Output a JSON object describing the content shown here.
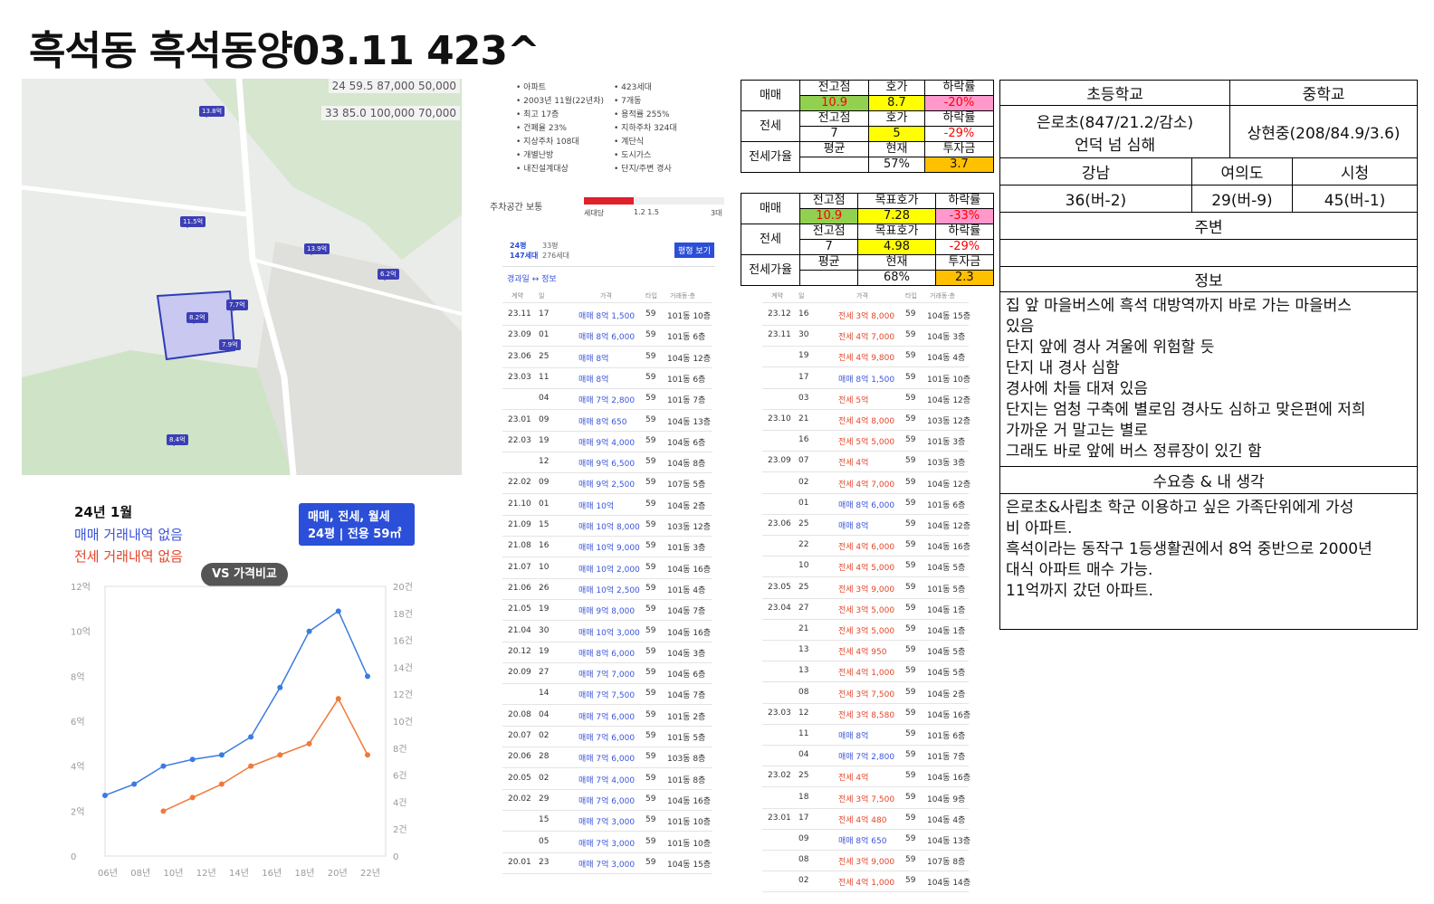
{
  "title": "흑석동 흑석동양03.11   423^",
  "map": {
    "legend_line1": "24 59.5 87,000 50,000",
    "legend_line2": "33 85.0 100,000 70,000",
    "pins": [
      "13.8억",
      "11.5억",
      "7.7억",
      "13.9억",
      "6.2억",
      "8.4억",
      "8.2억",
      "7.9억"
    ]
  },
  "chart": {
    "month": "24년 1월",
    "buy_none": "매매 거래내역 없음",
    "rent_none": "전세 거래내역 없음",
    "vs_label": "VS 가격비교",
    "filter_line1": "매매, 전세, 월세",
    "filter_line2": "24평 | 전용 59㎡",
    "left_ticks": [
      "12억",
      "10억",
      "8억",
      "6억",
      "4억",
      "2억",
      "0"
    ],
    "right_ticks": [
      "20건",
      "18건",
      "16건",
      "14건",
      "12건",
      "10건",
      "8건",
      "6건",
      "4건",
      "2건",
      "0"
    ],
    "x_ticks": [
      "06년",
      "08년",
      "10년",
      "12년",
      "14년",
      "16년",
      "18년",
      "20년",
      "22년"
    ]
  },
  "chart_data": {
    "type": "line",
    "x": [
      "2006",
      "2008",
      "2010",
      "2012",
      "2014",
      "2016",
      "2018",
      "2020",
      "2022",
      "2023"
    ],
    "series": [
      {
        "name": "매매",
        "values": [
          2.7,
          3.2,
          4.0,
          4.3,
          4.5,
          5.3,
          7.5,
          10.0,
          10.9,
          8.0
        ]
      },
      {
        "name": "전세",
        "values": [
          null,
          null,
          2.0,
          2.6,
          3.2,
          4.0,
          4.5,
          5.0,
          7.0,
          4.5
        ]
      }
    ],
    "ylim": [
      0,
      12
    ]
  },
  "complex_info": {
    "left": [
      "아파트",
      "2003년 11월(22년차)",
      "최고 17층",
      "건폐율 23%",
      "지상주차 108대",
      "개별난방",
      "내진설계대상"
    ],
    "right": [
      "423세대",
      "7개동",
      "용적률 255%",
      "지하주차 324대",
      "계단식",
      "도시가스",
      "단지/주변 경사"
    ]
  },
  "parking": {
    "label": "주차공간 보통",
    "axis": [
      "세대당",
      "1.2 1.5",
      "3대"
    ]
  },
  "type_tabs": {
    "tab1": "24평",
    "tab1_sub": "147세대",
    "tab2": "33평",
    "tab2_sub": "276세대",
    "button": "평형 보기",
    "history": "경과일 ↔ 정보"
  },
  "list_headers": {
    "date": "계약",
    "day": "일",
    "price": "가격",
    "type": "타입",
    "floor": "거래동·층"
  },
  "list1": [
    {
      "d": "23.11",
      "day": "17",
      "k": "매매",
      "p": "8억 1,500",
      "t": "59",
      "f": "101동 10층"
    },
    {
      "d": "23.09",
      "day": "01",
      "k": "매매",
      "p": "8억 6,000",
      "t": "59",
      "f": "101동 6층"
    },
    {
      "d": "23.06",
      "day": "25",
      "k": "매매",
      "p": "8억",
      "t": "59",
      "f": "104동 12층"
    },
    {
      "d": "23.03",
      "day": "11",
      "k": "매매",
      "p": "8억",
      "t": "59",
      "f": "101동 6층"
    },
    {
      "d": "",
      "day": "04",
      "k": "매매",
      "p": "7억 2,800",
      "t": "59",
      "f": "101동 7층"
    },
    {
      "d": "23.01",
      "day": "09",
      "k": "매매",
      "p": "8억 650",
      "t": "59",
      "f": "104동 13층"
    },
    {
      "d": "22.03",
      "day": "19",
      "k": "매매",
      "p": "9억 4,000",
      "t": "59",
      "f": "104동 6층"
    },
    {
      "d": "",
      "day": "12",
      "k": "매매",
      "p": "9억 6,500",
      "t": "59",
      "f": "104동 8층"
    },
    {
      "d": "22.02",
      "day": "09",
      "k": "매매",
      "p": "9억 2,500",
      "t": "59",
      "f": "107동 5층"
    },
    {
      "d": "21.10",
      "day": "01",
      "k": "매매",
      "p": "10억",
      "t": "59",
      "f": "104동 2층"
    },
    {
      "d": "21.09",
      "day": "15",
      "k": "매매",
      "p": "10억 8,000",
      "t": "59",
      "f": "103동 12층"
    },
    {
      "d": "21.08",
      "day": "16",
      "k": "매매",
      "p": "10억 9,000",
      "t": "59",
      "f": "101동 3층"
    },
    {
      "d": "21.07",
      "day": "10",
      "k": "매매",
      "p": "10억 2,000",
      "t": "59",
      "f": "104동 16층"
    },
    {
      "d": "21.06",
      "day": "26",
      "k": "매매",
      "p": "10억 2,500",
      "t": "59",
      "f": "101동 4층"
    },
    {
      "d": "21.05",
      "day": "19",
      "k": "매매",
      "p": "9억 8,000",
      "t": "59",
      "f": "104동 7층"
    },
    {
      "d": "21.04",
      "day": "30",
      "k": "매매",
      "p": "10억 3,000",
      "t": "59",
      "f": "104동 16층"
    },
    {
      "d": "20.12",
      "day": "19",
      "k": "매매",
      "p": "8억 6,000",
      "t": "59",
      "f": "104동 3층"
    },
    {
      "d": "20.09",
      "day": "27",
      "k": "매매",
      "p": "7억 7,000",
      "t": "59",
      "f": "104동 6층"
    },
    {
      "d": "",
      "day": "14",
      "k": "매매",
      "p": "7억 7,500",
      "t": "59",
      "f": "104동 7층"
    },
    {
      "d": "20.08",
      "day": "04",
      "k": "매매",
      "p": "7억 6,000",
      "t": "59",
      "f": "101동 2층"
    },
    {
      "d": "20.07",
      "day": "02",
      "k": "매매",
      "p": "7억 6,000",
      "t": "59",
      "f": "101동 5층"
    },
    {
      "d": "20.06",
      "day": "28",
      "k": "매매",
      "p": "7억 6,000",
      "t": "59",
      "f": "103동 8층"
    },
    {
      "d": "20.05",
      "day": "02",
      "k": "매매",
      "p": "7억 4,000",
      "t": "59",
      "f": "101동 8층"
    },
    {
      "d": "20.02",
      "day": "29",
      "k": "매매",
      "p": "7억 6,000",
      "t": "59",
      "f": "104동 16층"
    },
    {
      "d": "",
      "day": "15",
      "k": "매매",
      "p": "7억 3,000",
      "t": "59",
      "f": "101동 10층"
    },
    {
      "d": "",
      "day": "05",
      "k": "매매",
      "p": "7억 3,000",
      "t": "59",
      "f": "101동 10층"
    },
    {
      "d": "20.01",
      "day": "23",
      "k": "매매",
      "p": "7억 3,000",
      "t": "59",
      "f": "104동 15층"
    }
  ],
  "list2": [
    {
      "d": "23.12",
      "day": "16",
      "k": "전세",
      "p": "3억 8,000",
      "t": "59",
      "f": "104동 15층"
    },
    {
      "d": "23.11",
      "day": "30",
      "k": "전세",
      "p": "4억 7,000",
      "t": "59",
      "f": "104동 3층"
    },
    {
      "d": "",
      "day": "19",
      "k": "전세",
      "p": "4억 9,800",
      "t": "59",
      "f": "104동 4층"
    },
    {
      "d": "",
      "day": "17",
      "k": "매매",
      "p": "8억 1,500",
      "t": "59",
      "f": "101동 10층"
    },
    {
      "d": "",
      "day": "03",
      "k": "전세",
      "p": "5억",
      "t": "59",
      "f": "104동 12층"
    },
    {
      "d": "23.10",
      "day": "21",
      "k": "전세",
      "p": "4억 8,000",
      "t": "59",
      "f": "103동 12층"
    },
    {
      "d": "",
      "day": "16",
      "k": "전세",
      "p": "5억 5,000",
      "t": "59",
      "f": "101동 3층"
    },
    {
      "d": "23.09",
      "day": "07",
      "k": "전세",
      "p": "4억",
      "t": "59",
      "f": "103동 3층"
    },
    {
      "d": "",
      "day": "02",
      "k": "전세",
      "p": "4억 7,000",
      "t": "59",
      "f": "104동 12층"
    },
    {
      "d": "",
      "day": "01",
      "k": "매매",
      "p": "8억 6,000",
      "t": "59",
      "f": "101동 6층"
    },
    {
      "d": "23.06",
      "day": "25",
      "k": "매매",
      "p": "8억",
      "t": "59",
      "f": "104동 12층"
    },
    {
      "d": "",
      "day": "22",
      "k": "전세",
      "p": "4억 6,000",
      "t": "59",
      "f": "104동 16층"
    },
    {
      "d": "",
      "day": "10",
      "k": "전세",
      "p": "4억 5,000",
      "t": "59",
      "f": "104동 5층"
    },
    {
      "d": "23.05",
      "day": "25",
      "k": "전세",
      "p": "3억 9,000",
      "t": "59",
      "f": "101동 5층"
    },
    {
      "d": "23.04",
      "day": "27",
      "k": "전세",
      "p": "3억 5,000",
      "t": "59",
      "f": "104동 1층"
    },
    {
      "d": "",
      "day": "21",
      "k": "전세",
      "p": "3억 5,000",
      "t": "59",
      "f": "104동 1층"
    },
    {
      "d": "",
      "day": "13",
      "k": "전세",
      "p": "4억 950",
      "t": "59",
      "f": "104동 5층"
    },
    {
      "d": "",
      "day": "13",
      "k": "전세",
      "p": "4억 1,000",
      "t": "59",
      "f": "104동 5층"
    },
    {
      "d": "",
      "day": "08",
      "k": "전세",
      "p": "3억 7,500",
      "t": "59",
      "f": "104동 2층"
    },
    {
      "d": "23.03",
      "day": "12",
      "k": "전세",
      "p": "3억 8,580",
      "t": "59",
      "f": "104동 16층"
    },
    {
      "d": "",
      "day": "11",
      "k": "매매",
      "p": "8억",
      "t": "59",
      "f": "101동 6층"
    },
    {
      "d": "",
      "day": "04",
      "k": "매매",
      "p": "7억 2,800",
      "t": "59",
      "f": "101동 7층"
    },
    {
      "d": "23.02",
      "day": "25",
      "k": "전세",
      "p": "4억",
      "t": "59",
      "f": "104동 16층"
    },
    {
      "d": "",
      "day": "18",
      "k": "전세",
      "p": "3억 7,500",
      "t": "59",
      "f": "104동 9층"
    },
    {
      "d": "23.01",
      "day": "17",
      "k": "전세",
      "p": "4억 480",
      "t": "59",
      "f": "104동 4층"
    },
    {
      "d": "",
      "day": "09",
      "k": "매매",
      "p": "8억 650",
      "t": "59",
      "f": "104동 13층"
    },
    {
      "d": "",
      "day": "08",
      "k": "전세",
      "p": "3억 9,000",
      "t": "59",
      "f": "107동 8층"
    },
    {
      "d": "",
      "day": "02",
      "k": "전세",
      "p": "4억 1,000",
      "t": "59",
      "f": "104동 14층"
    }
  ],
  "price_table1": {
    "buy": "매매",
    "rent": "전세",
    "ratio": "전세가율",
    "h1": "전고점",
    "h2": "호가",
    "h3": "하락률",
    "h4": "평균",
    "h5": "현재",
    "h6": "투자금",
    "b1": "10.9",
    "b2": "8.7",
    "b3": "-20%",
    "r1": "7",
    "r2": "5",
    "r3": "-29%",
    "g1": "57%",
    "g2": "3.7"
  },
  "price_table2": {
    "buy": "매매",
    "rent": "전세",
    "ratio": "전세가율",
    "h1": "전고점",
    "h2": "목표호가",
    "h3": "하락률",
    "h4": "평균",
    "h5": "현재",
    "h6": "투자금",
    "b1": "10.9",
    "b2": "7.28",
    "b3": "-33%",
    "r1": "7",
    "r2": "4.98",
    "r3": "-29%",
    "g1": "68%",
    "g2": "2.3"
  },
  "school": {
    "elem_h": "초등학교",
    "mid_h": "중학교",
    "elem_l1": "은로초(847/21.2/감소)",
    "elem_l2": "언덕 넘 심해",
    "mid": "상현중(208/84.9/3.6)",
    "gangnam_h": "강남",
    "yeouido_h": "여의도",
    "cityhall_h": "시청",
    "gangnam": "36(버-2)",
    "yeouido": "29(버-9)",
    "cityhall": "45(버-1)",
    "surround_h": "주변",
    "info_h": "정보",
    "info": [
      "집 앞 마을버스에 흑석 대방역까지 바로 가는 마을버스",
      "있음",
      "단지 앞에 경사 겨울에 위험할 듯",
      "단지 내 경사 심함",
      "경사에 차들 대져 있음",
      "단지는 엄청 구축에 별로임 경사도 심하고 맞은편에 저희",
      "가까운 거 말고는 별로",
      "그래도 바로 앞에 버스 정류장이 있긴 함"
    ],
    "demand_h": "수요층 & 내 생각",
    "demand": [
      "은로초&사립초 학군 이용하고 싶은 가족단위에게 가성",
      "비 아파트.",
      "흑석이라는 동작구 1등생활권에서 8억 중반으로 2000년",
      "대식 아파트 매수 가능.",
      "11억까지 갔던 아파트."
    ]
  }
}
